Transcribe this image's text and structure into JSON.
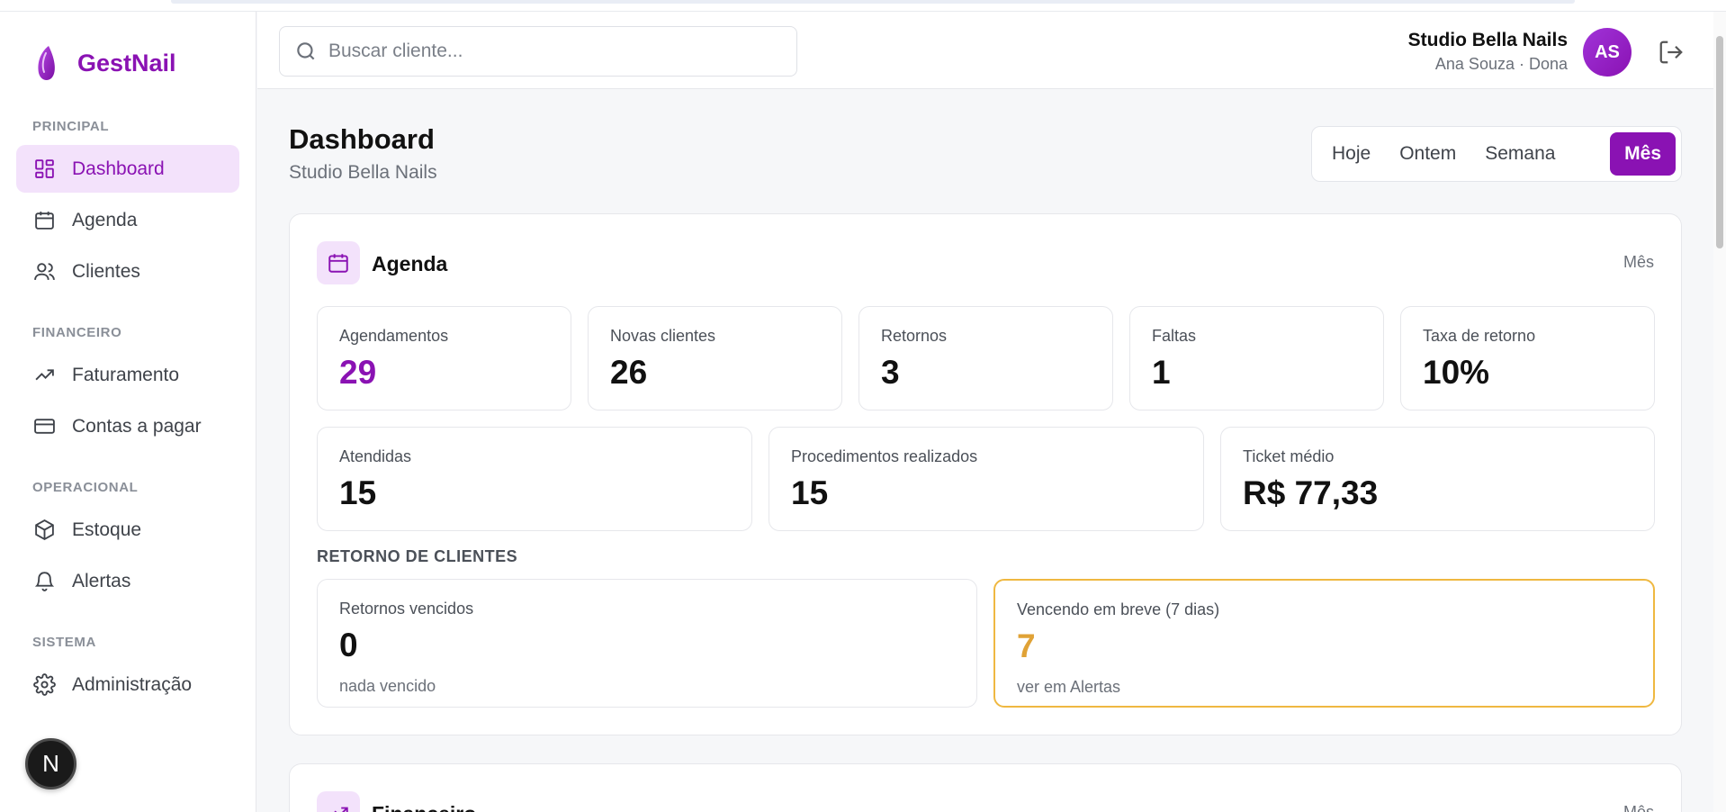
{
  "app": {
    "name": "GestNail"
  },
  "sidebar": {
    "sections": [
      {
        "title": "PRINCIPAL",
        "items": [
          {
            "label": "Dashboard",
            "icon": "dashboard-grid-icon",
            "active": true
          },
          {
            "label": "Agenda",
            "icon": "calendar-icon"
          },
          {
            "label": "Clientes",
            "icon": "users-icon"
          }
        ]
      },
      {
        "title": "FINANCEIRO",
        "items": [
          {
            "label": "Faturamento",
            "icon": "trending-up-icon"
          },
          {
            "label": "Contas a pagar",
            "icon": "credit-card-icon"
          }
        ]
      },
      {
        "title": "OPERACIONAL",
        "items": [
          {
            "label": "Estoque",
            "icon": "box-icon"
          },
          {
            "label": "Alertas",
            "icon": "bell-icon"
          }
        ]
      },
      {
        "title": "SISTEMA",
        "items": [
          {
            "label": "Administração",
            "icon": "gear-icon"
          }
        ]
      }
    ],
    "badge": "N"
  },
  "header": {
    "search_placeholder": "Buscar cliente...",
    "studio": "Studio Bella Nails",
    "user_role": "Ana Souza · Dona",
    "avatar_initials": "AS"
  },
  "page": {
    "title": "Dashboard",
    "subtitle": "Studio Bella Nails",
    "periods": [
      "Hoje",
      "Ontem",
      "Semana",
      "Mês"
    ],
    "active_period": "Mês"
  },
  "agenda_card": {
    "title": "Agenda",
    "period_link": "Mês",
    "row1": [
      {
        "label": "Agendamentos",
        "value": "29"
      },
      {
        "label": "Novas clientes",
        "value": "26"
      },
      {
        "label": "Retornos",
        "value": "3"
      },
      {
        "label": "Faltas",
        "value": "1"
      },
      {
        "label": "Taxa de retorno",
        "value": "10%"
      }
    ],
    "row2": [
      {
        "label": "Atendidas",
        "value": "15"
      },
      {
        "label": "Procedimentos realizados",
        "value": "15"
      },
      {
        "label": "Ticket médio",
        "value": "R$ 77,33"
      }
    ],
    "returns_section": "RETORNO DE CLIENTES",
    "returns": [
      {
        "label": "Retornos vencidos",
        "value": "0",
        "note": "nada vencido"
      },
      {
        "label": "Vencendo em breve (7 dias)",
        "value": "7",
        "note": "ver em Alertas"
      }
    ]
  },
  "finance_card": {
    "title": "Financeiro",
    "period_link": "Mês"
  },
  "colors": {
    "brand": "#8a12b3",
    "brand_light": "#f3e2fb",
    "warning": "#e0a236"
  }
}
